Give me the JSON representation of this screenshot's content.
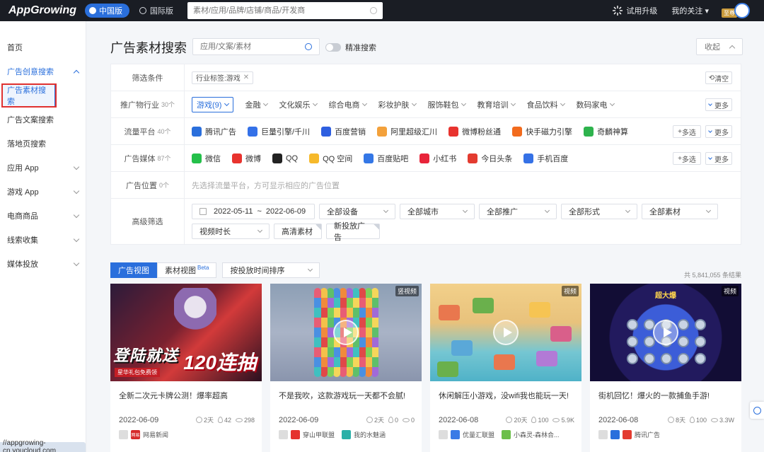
{
  "topbar": {
    "logo": "AppGrowing",
    "region_active": "中国版",
    "region_alt": "国际版",
    "search_placeholder": "素材/应用/品牌/店铺/商品/开发商",
    "trial": "试用升级",
    "follow": "我的关注",
    "vip": "至尊"
  },
  "sidebar": {
    "items": [
      {
        "label": "首页"
      },
      {
        "label": "广告创意搜索"
      },
      {
        "label": "广告素材搜索"
      },
      {
        "label": "广告文案搜索"
      },
      {
        "label": "落地页搜索"
      },
      {
        "label": "应用 App"
      },
      {
        "label": "游戏 App"
      },
      {
        "label": "电商商品"
      },
      {
        "label": "线索收集"
      },
      {
        "label": "媒体投放"
      }
    ],
    "status_url": "//appgrowing-cn.youcloud.com"
  },
  "main": {
    "title": "广告素材搜索",
    "search_placeholder": "应用/文案/素材",
    "precise": "精准搜索",
    "collapse": "收起"
  },
  "filters": {
    "conditions": {
      "label": "筛选条件",
      "chip": "行业标签:游戏",
      "clear": "清空"
    },
    "industry": {
      "label": "推广物行业",
      "count": "30个",
      "items": [
        "游戏(9)",
        "金融",
        "文化娱乐",
        "综合电商",
        "彩妆护肤",
        "服饰鞋包",
        "教育培训",
        "食品饮料",
        "数码家电"
      ],
      "more": "更多"
    },
    "traffic": {
      "label": "流量平台",
      "count": "40个",
      "items": [
        {
          "name": "腾讯广告",
          "color": "#2a6fdc"
        },
        {
          "name": "巨量引擎/千川",
          "color": "#3471e8"
        },
        {
          "name": "百度营销",
          "color": "#2e5fe0"
        },
        {
          "name": "阿里超级汇川",
          "color": "#f3a13b"
        },
        {
          "name": "微博粉丝通",
          "color": "#e8332e"
        },
        {
          "name": "快手磁力引擎",
          "color": "#f26b1d"
        },
        {
          "name": "奇麟神算",
          "color": "#2eb34d"
        }
      ],
      "multi": "多选",
      "more": "更多"
    },
    "media": {
      "label": "广告媒体",
      "count": "87个",
      "items": [
        {
          "name": "微信",
          "color": "#24c04a"
        },
        {
          "name": "微博",
          "color": "#e8332e"
        },
        {
          "name": "QQ",
          "color": "#222222"
        },
        {
          "name": "QQ 空间",
          "color": "#f6b92b"
        },
        {
          "name": "百度贴吧",
          "color": "#3477e6"
        },
        {
          "name": "小红书",
          "color": "#e8243a"
        },
        {
          "name": "今日头条",
          "color": "#e33b30"
        },
        {
          "name": "手机百度",
          "color": "#3571e6"
        }
      ],
      "multi": "多选",
      "more": "更多"
    },
    "position": {
      "label": "广告位置",
      "count": "0个",
      "hint": "先选择流量平台，方可显示相应的广告位置"
    },
    "advanced": {
      "label": "高级筛选",
      "date_start": "2022-05-11",
      "date_sep": "~",
      "date_end": "2022-06-09",
      "selects": [
        "全部设备",
        "全部城市",
        "全部推广",
        "全部形式",
        "全部素材"
      ],
      "row2": [
        "视频时长",
        "高清素材",
        "新投放广告"
      ]
    }
  },
  "results": {
    "tab_ad": "广告视图",
    "tab_material": "素材视图",
    "beta": "Beta",
    "sort": "按投放时间排序",
    "total": "共 5,841,055 条结果",
    "cards": [
      {
        "title": "全新二次元卡牌公测！爆率超高",
        "date": "2022-06-09",
        "days": "2天",
        "hot": "42",
        "views": "298",
        "badge": "",
        "slogan": "登陆就送",
        "slogan2": "120连抽",
        "sub": "星华礼包免费领",
        "media": [
          "网易新闻"
        ]
      },
      {
        "title": "不是我吹，这款游戏玩一天都不会腻!",
        "date": "2022-06-09",
        "days": "2天",
        "hot": "0",
        "views": "0",
        "badge": "竖视频",
        "media": [
          "穿山甲联盟",
          "我的水魅涵"
        ]
      },
      {
        "title": "休闲解压小游戏，没wifi我也能玩一天!",
        "date": "2022-06-08",
        "days": "20天",
        "hot": "100",
        "views": "5.9K",
        "badge": "视频",
        "media": [
          "优量汇联盟",
          "小森灵-森林合..."
        ]
      },
      {
        "title": "街机回忆！爆火的一款捕鱼手游!",
        "date": "2022-06-08",
        "days": "8天",
        "hot": "100",
        "views": "3.3W",
        "badge": "视频",
        "banner": "超大爆",
        "media": [
          "腾讯广告"
        ]
      }
    ]
  }
}
